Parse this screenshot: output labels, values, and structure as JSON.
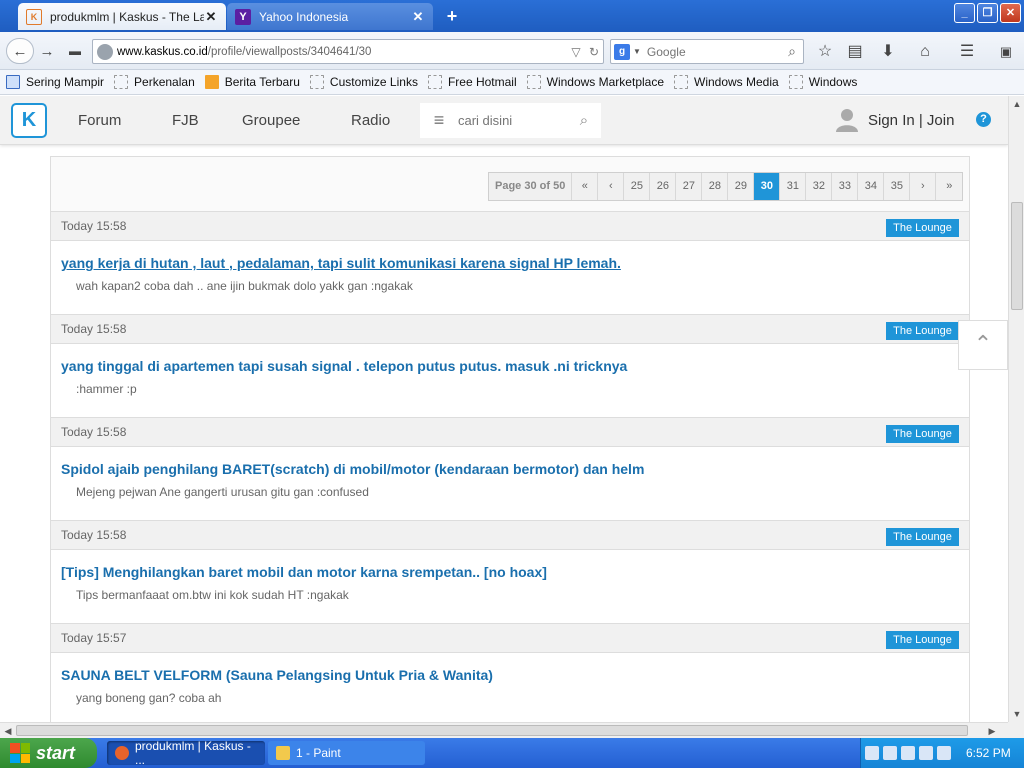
{
  "browser": {
    "tabs": [
      {
        "title": "produkmlm | Kaskus - The Lar...",
        "close": "✕",
        "active": true
      },
      {
        "title": "Yahoo Indonesia",
        "close": "✕",
        "active": false
      }
    ],
    "new_tab": "+",
    "window_buttons": {
      "minimize": "_",
      "maximize": "❐",
      "close": "✕"
    },
    "url_domain": "www.kaskus.co.id",
    "url_path": "/profile/viewallposts/3404641/30",
    "search_placeholder": "Google",
    "bookmarks": [
      {
        "label": "Sering Mampir",
        "icon": "bookmark-folder-icon"
      },
      {
        "label": "Perkenalan",
        "icon": "page-icon"
      },
      {
        "label": "Berita Terbaru",
        "icon": "rss-icon"
      },
      {
        "label": "Customize Links",
        "icon": "page-icon"
      },
      {
        "label": "Free Hotmail",
        "icon": "page-icon"
      },
      {
        "label": "Windows Marketplace",
        "icon": "page-icon"
      },
      {
        "label": "Windows Media",
        "icon": "page-icon"
      },
      {
        "label": "Windows",
        "icon": "page-icon"
      }
    ]
  },
  "site": {
    "logo_text": "K",
    "nav": [
      "Forum",
      "FJB",
      "Groupee",
      "Radio"
    ],
    "search_placeholder": "cari disini",
    "signin": "Sign In | Join",
    "help": "?"
  },
  "pager": {
    "info": "Page 30 of 50",
    "first": "«",
    "prev": "‹",
    "pages": [
      "25",
      "26",
      "27",
      "28",
      "29",
      "30",
      "31",
      "32",
      "33",
      "34",
      "35"
    ],
    "current": "30",
    "next": "›",
    "last": "»"
  },
  "posts": [
    {
      "time": "Today 15:58",
      "forum": "The Lounge",
      "title": "yang kerja di hutan , laut , pedalaman, tapi sulit komunikasi karena signal HP lemah.",
      "excerpt": "wah kapan2 coba dah .. ane ijin bukmak dolo yakk gan :ngakak",
      "underlined": true
    },
    {
      "time": "Today 15:58",
      "forum": "The Lounge",
      "title": "yang tinggal di apartemen tapi susah signal . telepon putus putus. masuk .ni tricknya",
      "excerpt": ":hammer :p",
      "underlined": false
    },
    {
      "time": "Today 15:58",
      "forum": "The Lounge",
      "title": "Spidol ajaib penghilang BARET(scratch) di mobil/motor (kendaraan bermotor) dan helm",
      "excerpt": "Mejeng pejwan Ane gangerti urusan gitu gan :confused",
      "underlined": false
    },
    {
      "time": "Today 15:58",
      "forum": "The Lounge",
      "title": "[Tips] Menghilangkan baret mobil dan motor karna srempetan.. [no hoax]",
      "excerpt": "Tips bermanfaaat om.btw ini kok sudah HT :ngakak",
      "underlined": false
    },
    {
      "time": "Today 15:57",
      "forum": "The Lounge",
      "title": "SAUNA BELT VELFORM (Sauna Pelangsing Untuk Pria & Wanita)",
      "excerpt": "yang boneng gan? coba ah",
      "underlined": false
    }
  ],
  "back_to_top": "⌃",
  "taskbar": {
    "start": "start",
    "tasks": [
      {
        "label": "produkmlm | Kaskus - ...",
        "icon": "firefox-icon"
      },
      {
        "label": "1 - Paint",
        "icon": "paint-icon"
      }
    ],
    "clock": "6:52 PM"
  },
  "colors": {
    "accent": "#1f95d8",
    "link": "#1a6fad",
    "titlebar": "#2a6fd6",
    "start": "#2f8a2f"
  }
}
